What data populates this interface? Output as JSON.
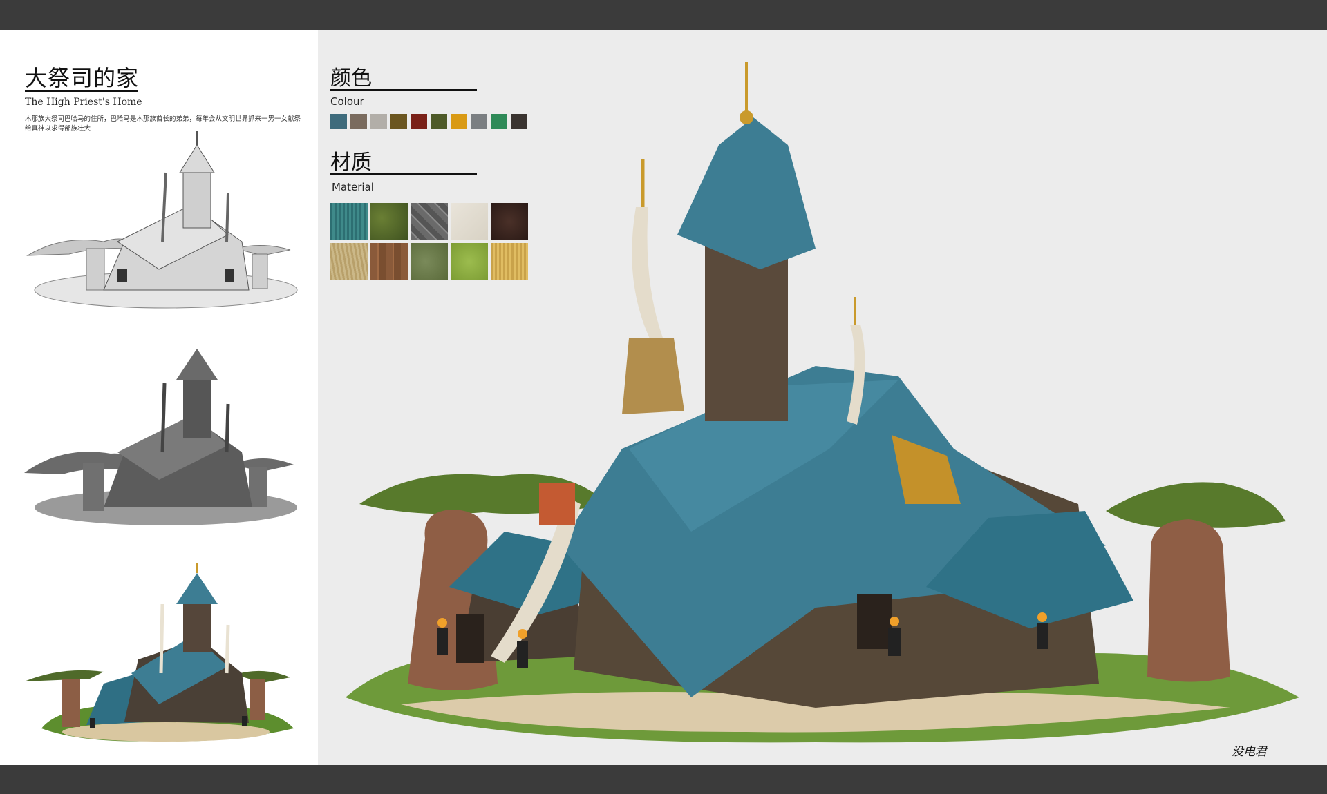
{
  "header": {
    "title_cn": "大祭司的家",
    "title_en": "The High Priest's Home",
    "description": "木那族大祭司巴哈马的住所，巴哈马是木那族酋长的弟弟，每年会从文明世界抓来一男一女献祭给真神以求得部族壮大"
  },
  "colour_section": {
    "title_cn": "颜色",
    "title_en": "Colour",
    "swatches": [
      "#3e6b7c",
      "#7a6b5e",
      "#b2aea8",
      "#6b5620",
      "#7a2118",
      "#4e5a28",
      "#d99a14",
      "#7b7f82",
      "#2f8a58",
      "#3a3430"
    ]
  },
  "material_section": {
    "title_cn": "材质",
    "title_en": "Material",
    "textures": [
      "teal-thatch",
      "moss-grass",
      "stone-wall",
      "linen-cloth",
      "dark-leather",
      "straw-bundle",
      "wood-planks",
      "grass-dirt",
      "light-grass",
      "golden-reed"
    ]
  },
  "signature": "没电君",
  "colors": {
    "roof_blue": "#3d7d93",
    "bg_light": "#ececec",
    "bar_dark": "#3b3b3b"
  }
}
